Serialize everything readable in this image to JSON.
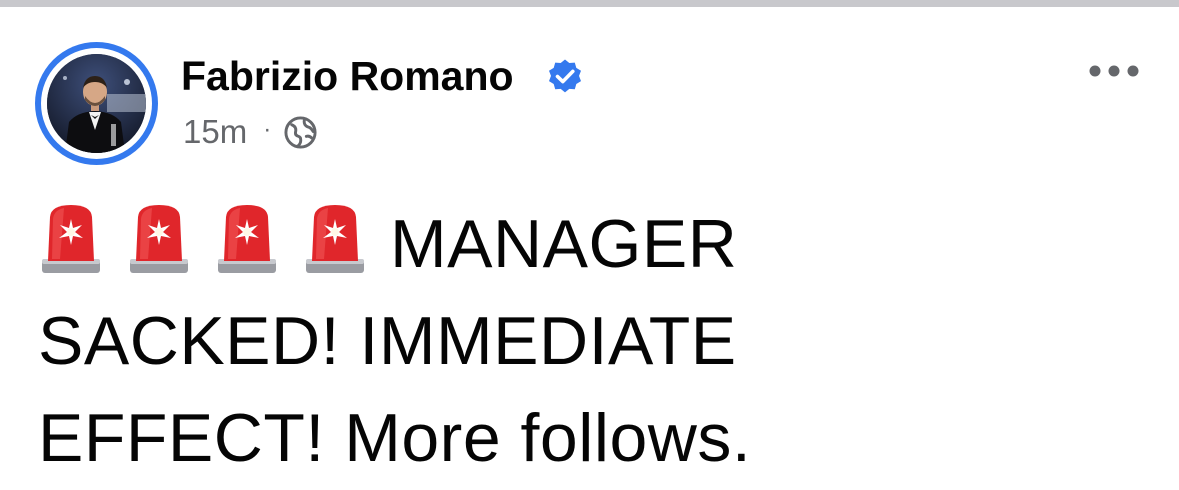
{
  "post": {
    "author": {
      "name": "Fabrizio Romano",
      "verified": true,
      "avatar_icon": "profile-photo"
    },
    "timestamp": "15m",
    "separator": "·",
    "audience_icon": "globe-icon",
    "more_icon": "more-options-icon",
    "body": {
      "emoji": [
        "🚨",
        "🚨",
        "🚨",
        "🚨"
      ],
      "emoji_icon": "police-siren-icon",
      "text": "MANAGER SACKED! IMMEDIATE EFFECT! More follows."
    }
  },
  "colors": {
    "accent_blue": "#3479ee",
    "text_primary": "#050505",
    "text_secondary": "#65676b",
    "siren_red": "#e0262b"
  }
}
